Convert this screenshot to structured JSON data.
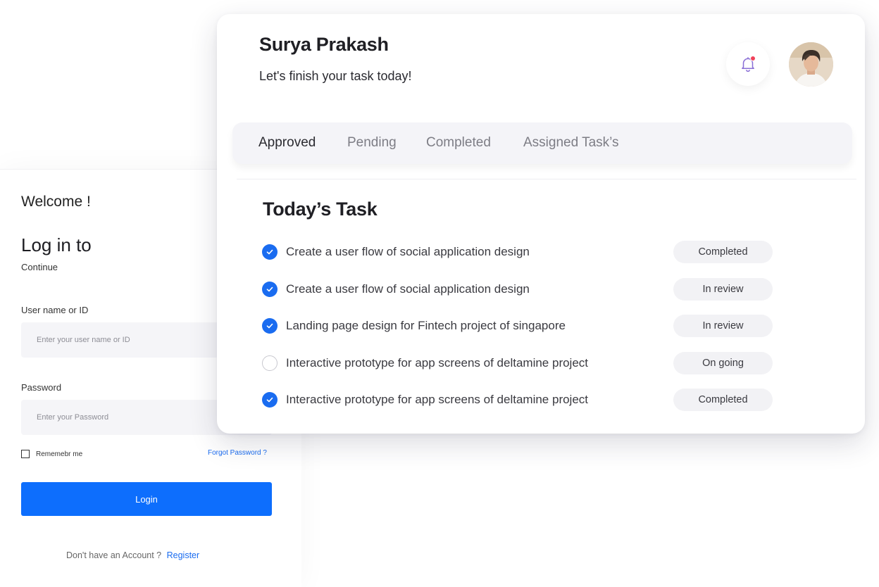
{
  "login": {
    "welcome": "Welcome !",
    "title": "Log in to",
    "subtitle": "Continue",
    "username_label": "User name or ID",
    "username_placeholder": "Enter your user name or ID",
    "password_label": "Password",
    "password_placeholder": "Enter your Password",
    "remember_label": "Rememebr me",
    "forgot_label": "Forgot Password ?",
    "login_button": "Login",
    "no_account_text": "Don't have an Account ?",
    "register_label": "Register"
  },
  "header": {
    "user_name": "Surya Prakash",
    "subtitle": "Let's finish your task today!",
    "notification_icon": "bell-icon",
    "has_notification": true
  },
  "tabs": [
    {
      "label": "Approved",
      "active": true
    },
    {
      "label": "Pending",
      "active": false
    },
    {
      "label": "Completed",
      "active": false
    },
    {
      "label": "Assigned Task’s",
      "active": false
    }
  ],
  "tasks_section": {
    "title": "Today’s Task",
    "tasks": [
      {
        "text": "Create a user flow of social application design",
        "status": "Completed",
        "checked": true
      },
      {
        "text": "Create a user flow of social application design",
        "status": "In review",
        "checked": true
      },
      {
        "text": "Landing page design for Fintech project of singapore",
        "status": "In review",
        "checked": true
      },
      {
        "text": "Interactive prototype for app screens of deltamine project",
        "status": "On going",
        "checked": false
      },
      {
        "text": "Interactive prototype for app screens of deltamine project",
        "status": "Completed",
        "checked": true
      }
    ]
  },
  "colors": {
    "accent": "#0d6efd",
    "notification_dot": "#f0425a",
    "badge_bg": "#f2f2f5",
    "tab_bar_bg": "#f4f4f8"
  }
}
